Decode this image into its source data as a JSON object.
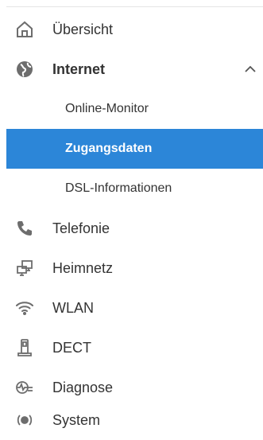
{
  "nav": {
    "items": [
      {
        "label": "Übersicht",
        "icon": "home-icon"
      },
      {
        "label": "Internet",
        "icon": "globe-icon",
        "expanded": true
      },
      {
        "label": "Telefonie",
        "icon": "phone-icon"
      },
      {
        "label": "Heimnetz",
        "icon": "network-icon"
      },
      {
        "label": "WLAN",
        "icon": "wifi-icon"
      },
      {
        "label": "DECT",
        "icon": "dect-icon"
      },
      {
        "label": "Diagnose",
        "icon": "diagnose-icon"
      },
      {
        "label": "System",
        "icon": "system-icon"
      }
    ],
    "internet_sub": [
      {
        "label": "Online-Monitor"
      },
      {
        "label": "Zugangsdaten",
        "active": true
      },
      {
        "label": "DSL-Informationen"
      }
    ]
  },
  "colors": {
    "accent": "#2c86d8",
    "text": "#333333",
    "icon": "#6d6d6d"
  }
}
